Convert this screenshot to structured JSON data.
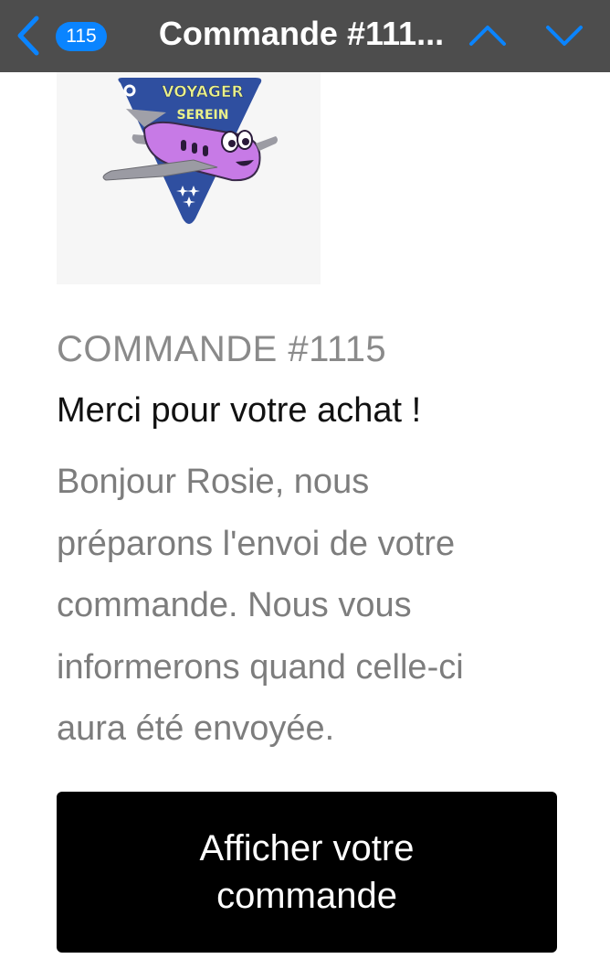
{
  "header": {
    "unread_count": "115",
    "title": "Commande #111...",
    "back_icon": "chevron-left-icon",
    "up_icon": "chevron-up-icon",
    "down_icon": "chevron-down-icon",
    "bar_color": "#4d4d4d",
    "accent_color": "#0a84ff"
  },
  "logo": {
    "line1": "VOYAGER",
    "line2": "SEREIN",
    "icon": "airplane-badge-logo",
    "badge_color": "#2f4fa0",
    "plane_color": "#c77ae6"
  },
  "email": {
    "order_label": "COMMANDE #1115",
    "headline": "Merci pour votre achat !",
    "body_lines": [
      "Bonjour Rosie, nous",
      "préparons l'envoi de votre",
      "commande. Nous vous",
      "informerons quand celle-ci",
      "aura été envoyée."
    ],
    "cta_lines": [
      "Afficher votre",
      "commande"
    ]
  }
}
